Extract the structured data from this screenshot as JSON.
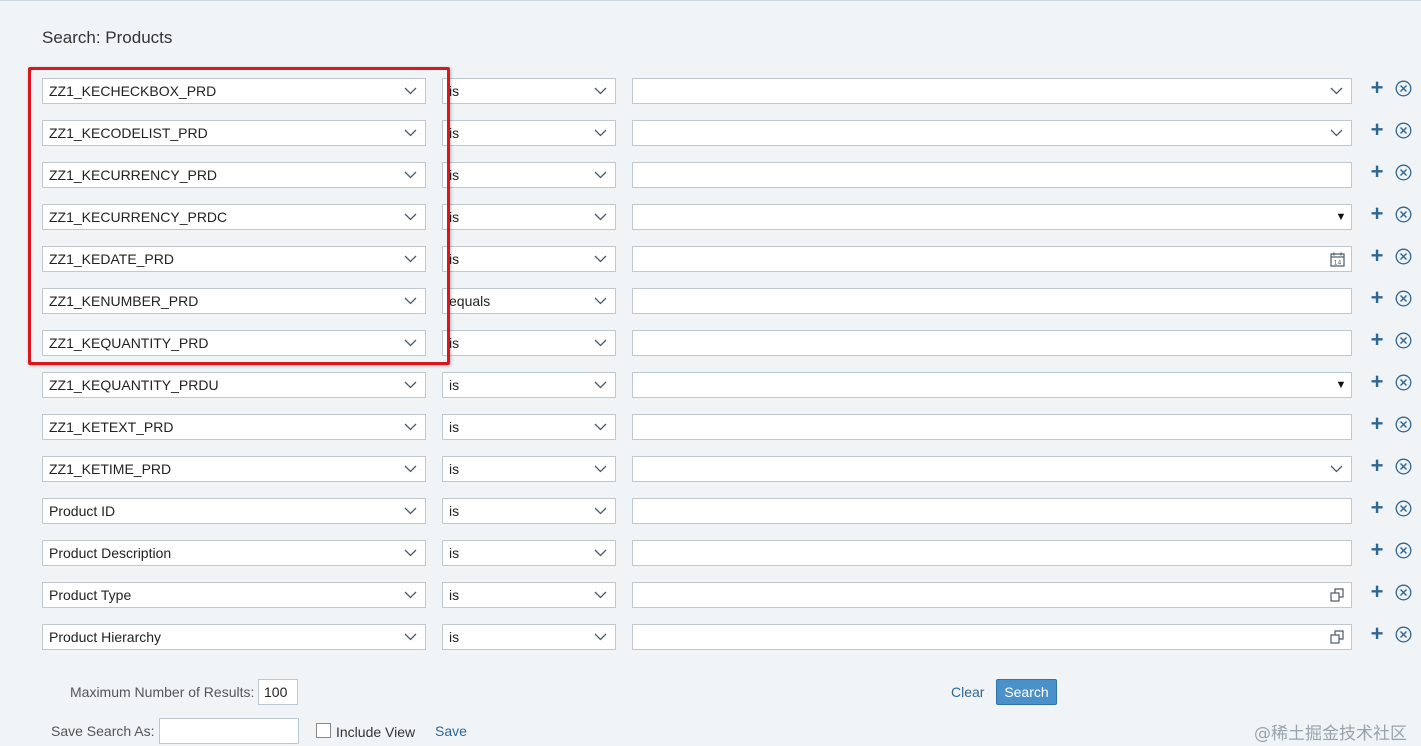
{
  "page": {
    "title": "Search: Products"
  },
  "rows": [
    {
      "field": "ZZ1_KECHECKBOX_PRD",
      "operator": "is",
      "value": "",
      "value_control": "dropdown"
    },
    {
      "field": "ZZ1_KECODELIST_PRD",
      "operator": "is",
      "value": "",
      "value_control": "dropdown"
    },
    {
      "field": "ZZ1_KECURRENCY_PRD",
      "operator": "is",
      "value": "",
      "value_control": "text"
    },
    {
      "field": "ZZ1_KECURRENCY_PRDC",
      "operator": "is",
      "value": "",
      "value_control": "select"
    },
    {
      "field": "ZZ1_KEDATE_PRD",
      "operator": "is",
      "value": "",
      "value_control": "date"
    },
    {
      "field": "ZZ1_KENUMBER_PRD",
      "operator": "equals",
      "value": "",
      "value_control": "text"
    },
    {
      "field": "ZZ1_KEQUANTITY_PRD",
      "operator": "is",
      "value": "",
      "value_control": "text"
    },
    {
      "field": "ZZ1_KEQUANTITY_PRDU",
      "operator": "is",
      "value": "",
      "value_control": "select"
    },
    {
      "field": "ZZ1_KETEXT_PRD",
      "operator": "is",
      "value": "",
      "value_control": "text"
    },
    {
      "field": "ZZ1_KETIME_PRD",
      "operator": "is",
      "value": "",
      "value_control": "dropdown"
    },
    {
      "field": "Product ID",
      "operator": "is",
      "value": "",
      "value_control": "text"
    },
    {
      "field": "Product Description",
      "operator": "is",
      "value": "",
      "value_control": "text"
    },
    {
      "field": "Product Type",
      "operator": "is",
      "value": "",
      "value_control": "valuehelp"
    },
    {
      "field": "Product Hierarchy",
      "operator": "is",
      "value": "",
      "value_control": "valuehelp"
    }
  ],
  "footer": {
    "max_results_label": "Maximum Number of Results:",
    "max_results_value": "100",
    "clear_label": "Clear",
    "search_label": "Search",
    "save_search_label": "Save Search As:",
    "save_search_value": "",
    "include_view_label": "Include View",
    "include_view_checked": false,
    "save_label": "Save"
  },
  "watermark": "@稀土掘金技术社区",
  "colors": {
    "accent": "#2f6792",
    "button": "#4a90c9",
    "highlight": "#d9161c",
    "background": "#f0f4f7"
  }
}
